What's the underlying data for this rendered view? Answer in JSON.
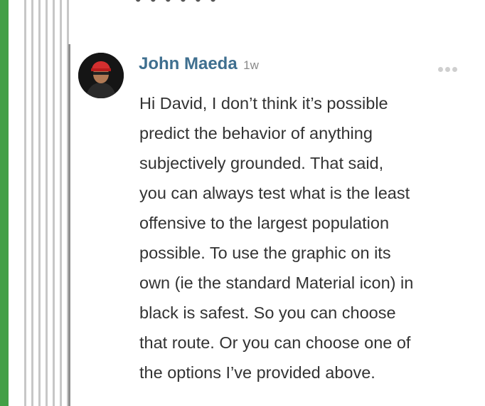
{
  "top_snippet": "• • • • • •",
  "comment": {
    "author": "John Maeda",
    "timestamp": "1w",
    "more_icon": "ellipsis-icon",
    "avatar_icon": "user-avatar",
    "body_lines": [
      "Hi David, I don’t think it’s possible",
      "predict the behavior of anything",
      "subjectively grounded. That said,",
      "you can always test what is the least",
      "offensive to the largest population",
      "possible. To use the graphic on its",
      "own (ie the standard Material icon) in",
      "black is safest. So you can choose",
      "that route. Or you can choose one of",
      "the options I’ve provided above."
    ]
  },
  "colors": {
    "author": "#3f6f8f",
    "rail": "#43a047",
    "hat": "#d32f2f"
  }
}
